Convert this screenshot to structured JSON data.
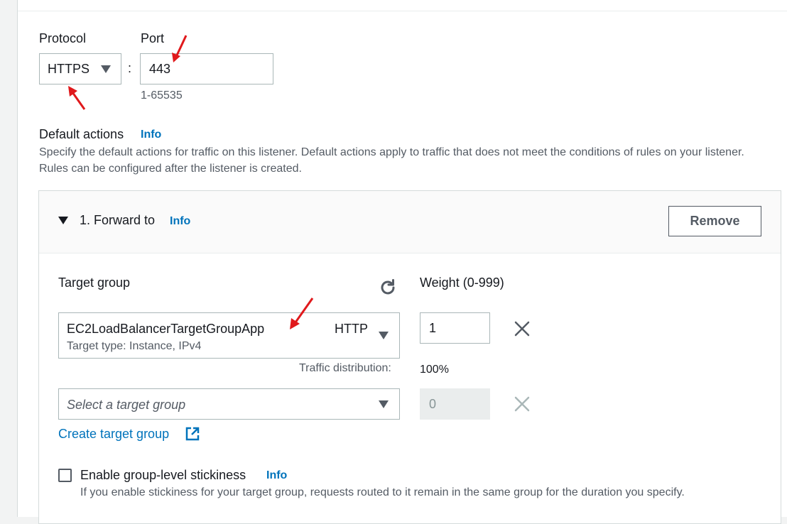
{
  "listener": {
    "protocol_label": "Protocol",
    "protocol_value": "HTTPS",
    "port_label": "Port",
    "port_value": "443",
    "port_hint": "1-65535",
    "separator": ":"
  },
  "default_actions": {
    "title": "Default actions",
    "info": "Info",
    "description": "Specify the default actions for traffic on this listener. Default actions apply to traffic that does not meet the conditions of rules on your listener. Rules can be configured after the listener is created."
  },
  "action": {
    "title": "1. Forward to",
    "info": "Info",
    "remove_label": "Remove",
    "target_group_label": "Target group",
    "weight_label": "Weight (0-999)",
    "target_group_1": {
      "name": "EC2LoadBalancerTargetGroupApp",
      "protocol": "HTTP",
      "subtitle": "Target type: Instance, IPv4",
      "weight": "1"
    },
    "traffic_distribution_label": "Traffic distribution:",
    "traffic_distribution_value": "100%",
    "target_group_2": {
      "placeholder": "Select a target group",
      "weight": "0"
    },
    "create_target_group_label": "Create target group",
    "stickiness": {
      "label": "Enable group-level stickiness",
      "info": "Info",
      "checked": false,
      "description": "If you enable stickiness for your target group, requests routed to it remain in the same group for the duration you specify."
    }
  },
  "colors": {
    "link": "#0073bb",
    "annotation_arrow": "#e0191c",
    "border": "#aab7b8"
  },
  "icons": [
    "caret-down-icon",
    "refresh-icon",
    "close-icon",
    "external-link-icon"
  ]
}
